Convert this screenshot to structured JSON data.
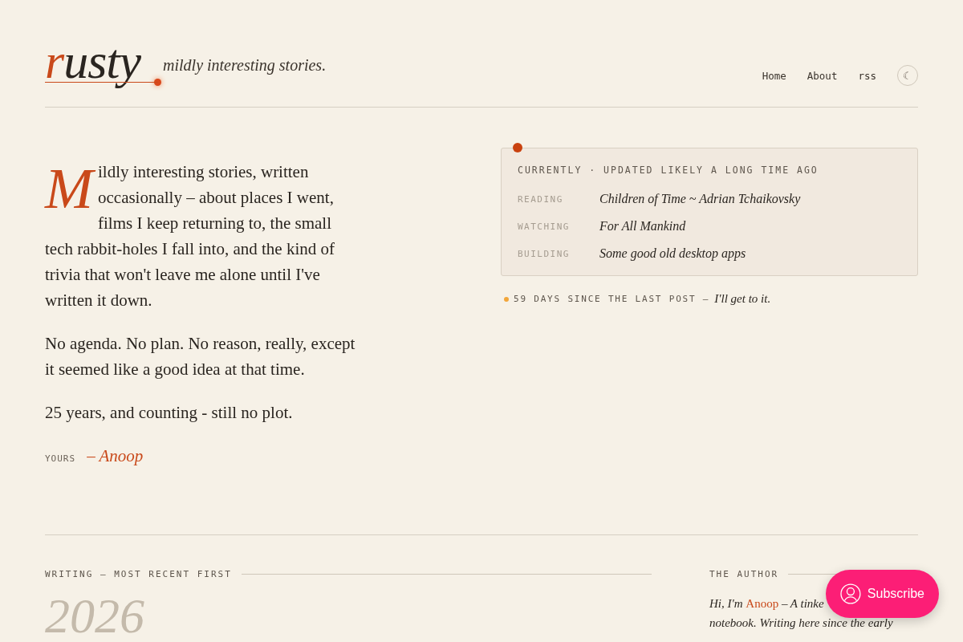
{
  "header": {
    "logo_first": "r",
    "logo_rest": "usty",
    "tagline": "mildly interesting stories.",
    "nav": [
      {
        "label": "Home"
      },
      {
        "label": "About"
      },
      {
        "label": "rss"
      }
    ],
    "theme_toggle": "☾"
  },
  "intro": {
    "drop_cap": "M",
    "paragraphs": [
      "ildly interesting stories, written occasionally – about places I went, films I keep returning to, the small tech rabbit-holes I fall into, and the kind of trivia that won't leave me alone until I've written it down.",
      "No agenda. No plan. No reason, really, except it seemed like a good idea at that time.",
      "25 years, and counting - still no plot."
    ],
    "signoff_label": "YOURS",
    "signoff_name": "– Anoop"
  },
  "currently": {
    "title": "CURRENTLY · UPDATED LIKELY A LONG TIME AGO",
    "rows": [
      {
        "label": "READING",
        "value": "Children of Time ~ Adrian Tchaikovsky"
      },
      {
        "label": "WATCHING",
        "value": "For All Mankind"
      },
      {
        "label": "BUILDING",
        "value": "Some good old desktop apps"
      }
    ],
    "status": "59 DAYS SINCE THE LAST POST —",
    "status_note": "I'll get to it."
  },
  "writing": {
    "heading": "WRITING — MOST RECENT FIRST",
    "year": "2026"
  },
  "author": {
    "heading": "THE AUTHOR",
    "before": "Hi, I'm ",
    "name": "Anoop",
    "after": " – A tinke",
    "lines": [
      "notebook. Writing here since the early"
    ]
  },
  "subscribe": {
    "label": "Subscribe"
  }
}
